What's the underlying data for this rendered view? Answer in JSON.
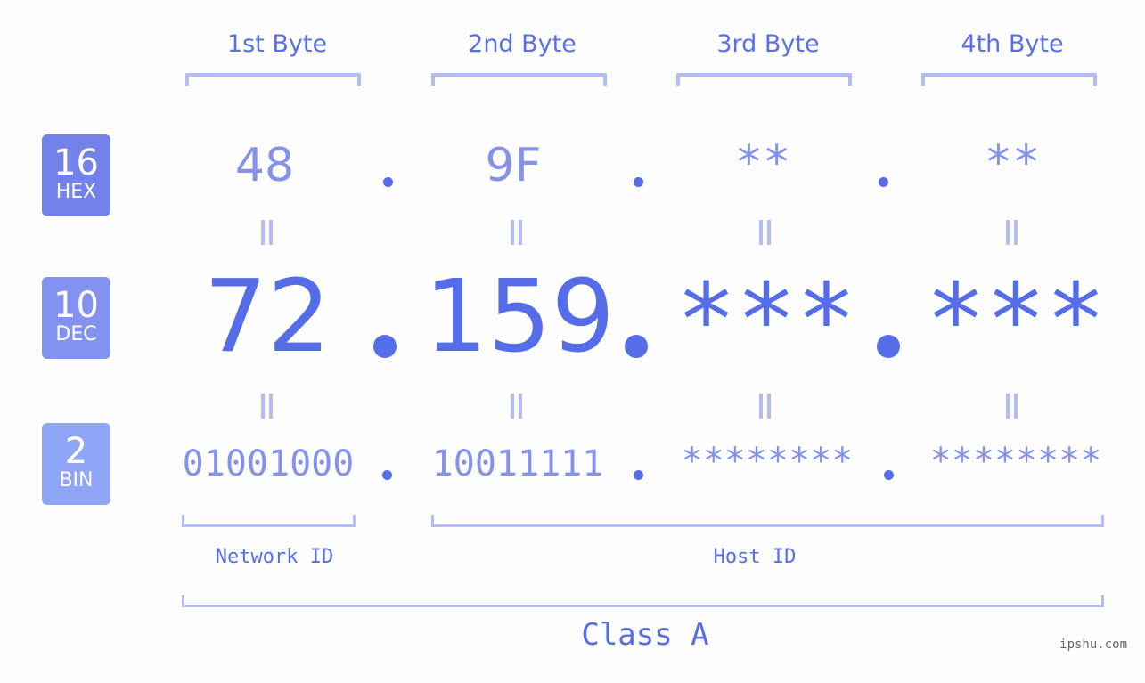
{
  "bytes": [
    {
      "header": "1st Byte",
      "hex": "48",
      "dec": "72",
      "bin": "01001000"
    },
    {
      "header": "2nd Byte",
      "hex": "9F",
      "dec": "159",
      "bin": "10011111"
    },
    {
      "header": "3rd Byte",
      "hex": "**",
      "dec": "***",
      "bin": "********"
    },
    {
      "header": "4th Byte",
      "hex": "**",
      "dec": "***",
      "bin": "********"
    }
  ],
  "bases": [
    {
      "number": "16",
      "label": "HEX",
      "color": "#7282ea"
    },
    {
      "number": "10",
      "label": "DEC",
      "color": "#8392f0"
    },
    {
      "number": "2",
      "label": "BIN",
      "color": "#8fa6f7"
    }
  ],
  "labels": {
    "network_id": "Network ID",
    "host_id": "Host ID",
    "class": "Class A"
  },
  "watermark": "ipshu.com",
  "colors": {
    "primary": "#566de9",
    "light": "#8592ec",
    "bracket": "#b3bcf6",
    "background": "#fcfdfc"
  }
}
